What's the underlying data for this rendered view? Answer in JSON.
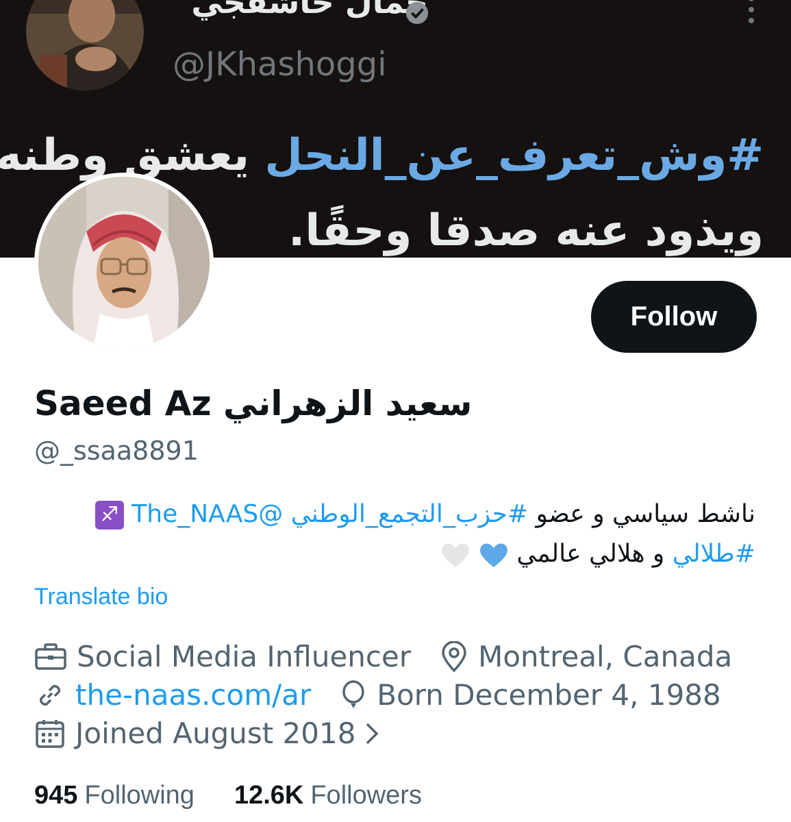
{
  "banner": {
    "tweet_author_name": "جمال خاشقجي",
    "tweet_author_handle": "@JKhashoggi",
    "tweet_hashtag": "#وش_تعرف_عن_النحل",
    "tweet_line1_rest": "يعشق وطنه",
    "tweet_line2": "ويذود عنه صدقا وحقًا."
  },
  "profile": {
    "display_name": "Saeed Az سعيد الزهراني",
    "handle": "@_ssaa8891",
    "follow_label": "Follow"
  },
  "bio": {
    "part1": "ناشط سياسي و عضو ",
    "hashtag1": "#حزب_التجمع_الوطني",
    "mention": "@The_NAAS",
    "sign": "♐",
    "hashtag2": "#طلالي",
    "part2": " و هلالي عالمي ",
    "translate_label": "Translate bio"
  },
  "info": {
    "profession": "Social Media Influencer",
    "location": "Montreal, Canada",
    "website": "the-naas.com/ar",
    "birthday": "Born December 4, 1988",
    "joined": "Joined August 2018"
  },
  "stats": {
    "following_count": "945",
    "following_label": "Following",
    "followers_count": "12.6K",
    "followers_label": "Followers"
  },
  "colors": {
    "accent": "#1d9bf0",
    "text_primary": "#0f1419",
    "text_secondary": "#536471",
    "button_bg": "#0f1419",
    "heart_blue": "#5fa8e8",
    "heart_white": "#e6e6e6"
  },
  "icons": [
    "verified-badge-icon",
    "more-icon",
    "briefcase-icon",
    "location-pin-icon",
    "link-icon",
    "balloon-icon",
    "calendar-icon",
    "chevron-right-icon",
    "sagittarius-icon",
    "blue-heart-icon",
    "white-heart-icon"
  ]
}
